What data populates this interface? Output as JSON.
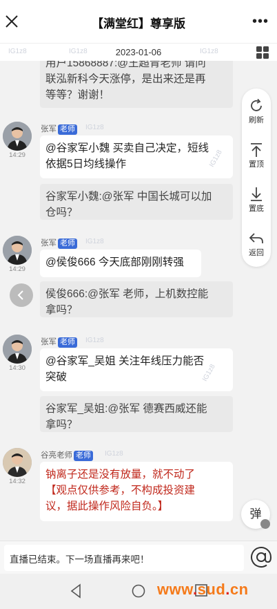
{
  "header": {
    "title": "【满堂红】尊享版",
    "date": "2023-01-06"
  },
  "watermark": "IG1z8",
  "messages": {
    "top_partial": {
      "line1": "用户15868887:@王超青老师 请问",
      "line2": "联泓新科今天涨停，是出来还是再",
      "line3": "等等？谢谢！"
    },
    "m1": {
      "name": "张军",
      "badge": "老师",
      "time": "14:29",
      "reply_line1": "@谷家军小魏 买卖自己决定，短线",
      "reply_line2": "依据5日均线操作",
      "quote_line1": "谷家军小魏:@张军 中国长城可以加",
      "quote_line2": "仓吗？"
    },
    "m2": {
      "name": "张军",
      "badge": "老师",
      "time": "14:29",
      "reply_line1": "@侯俊666 今天底部刚刚转强",
      "quote_line1": "侯俊666:@张军 老师，上机数控能",
      "quote_line2": "拿吗？"
    },
    "m3": {
      "name": "张军",
      "badge": "老师",
      "time": "14:30",
      "reply_line1": "@谷家军_吴姐 关注年线压力能否",
      "reply_line2": "突破",
      "quote_line1": "谷家军_吴姐:@张军 德赛西威还能",
      "quote_line2": "拿吗？"
    },
    "m4": {
      "name": "谷亮老师",
      "badge": "老师",
      "time": "14:32",
      "line1": "钠离子还是没有放量，就不动了",
      "line2": "【观点仅供参考，不构成投资建",
      "line3": "议，据此操作风险自负。】"
    }
  },
  "side_actions": {
    "refresh": "刷新",
    "top": "置顶",
    "bottom": "置底",
    "back": "返回"
  },
  "danmu_label": "弹",
  "input": {
    "placeholder": "直播已结束。下一场直播再来吧！"
  },
  "footer_watermark": {
    "prefix": "www",
    "dot": ".",
    "mid": "sud",
    "dot2": ".",
    "suffix": "cn"
  },
  "colors": {
    "badge": "#3a6bd8",
    "red_text": "#c0281c",
    "watermark_orange": "#f57a1a"
  }
}
